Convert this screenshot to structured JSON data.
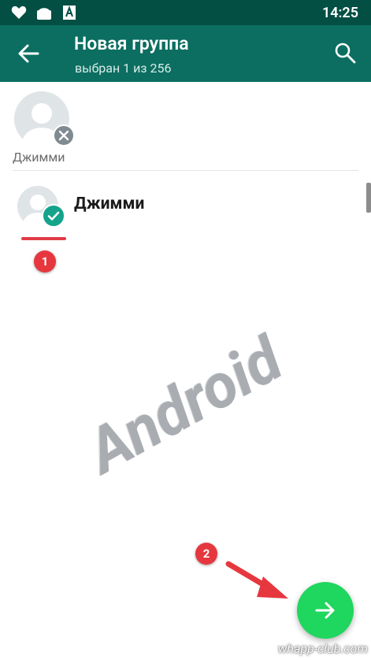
{
  "status_bar": {
    "time": "14:25",
    "icons": [
      "heart-icon",
      "android-icon",
      "font-icon"
    ]
  },
  "toolbar": {
    "title": "Новая группа",
    "subtitle": "выбран 1 из 256",
    "back_icon": "arrow-left-icon",
    "search_icon": "search-icon",
    "background": "#0b6e60"
  },
  "selected": [
    {
      "name": "Джимми"
    }
  ],
  "contacts": [
    {
      "name": "Джимми",
      "checked": true
    }
  ],
  "annotations": {
    "step1": "1",
    "step2": "2"
  },
  "watermark": "Android",
  "site_watermark": "whapp-club.com",
  "fab": {
    "icon": "arrow-right-icon",
    "color": "#1fd65e"
  }
}
